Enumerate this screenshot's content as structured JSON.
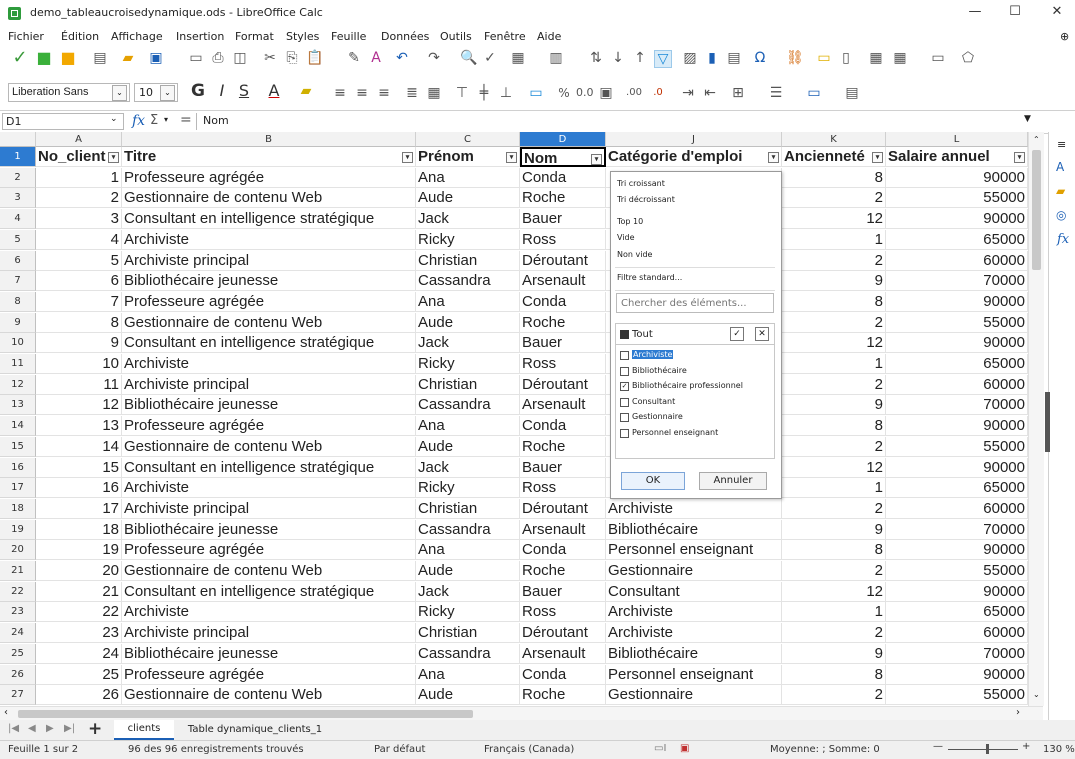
{
  "window": {
    "title": "demo_tableaucroisedynamique.ods - LibreOffice Calc"
  },
  "menu": [
    "Fichier",
    "Édition",
    "Affichage",
    "Insertion",
    "Format",
    "Styles",
    "Feuille",
    "Données",
    "Outils",
    "Fenêtre",
    "Aide"
  ],
  "toolbar": {
    "font_name": "Liberation Sans",
    "font_size": "10"
  },
  "formula_bar": {
    "cell_ref": "D1",
    "content": "Nom"
  },
  "columns": [
    "A",
    "B",
    "C",
    "D",
    "J",
    "K",
    "L"
  ],
  "headers": [
    "No_client",
    "Titre",
    "Prénom",
    "Nom",
    "Catégorie d'emploi",
    "Ancienneté",
    "Salaire annuel"
  ],
  "rows": [
    [
      "1",
      "Professeure agrégée",
      "Ana",
      "Conda",
      "",
      "8",
      "90000"
    ],
    [
      "2",
      "Gestionnaire de contenu Web",
      "Aude",
      "Roche",
      "",
      "2",
      "55000"
    ],
    [
      "3",
      "Consultant en intelligence stratégique",
      "Jack",
      "Bauer",
      "",
      "12",
      "90000"
    ],
    [
      "4",
      "Archiviste",
      "Ricky",
      "Ross",
      "",
      "1",
      "65000"
    ],
    [
      "5",
      "Archiviste principal",
      "Christian",
      "Déroutant",
      "",
      "2",
      "60000"
    ],
    [
      "6",
      "Bibliothécaire jeunesse",
      "Cassandra",
      "Arsenault",
      "",
      "9",
      "70000"
    ],
    [
      "7",
      "Professeure agrégée",
      "Ana",
      "Conda",
      "",
      "8",
      "90000"
    ],
    [
      "8",
      "Gestionnaire de contenu Web",
      "Aude",
      "Roche",
      "",
      "2",
      "55000"
    ],
    [
      "9",
      "Consultant en intelligence stratégique",
      "Jack",
      "Bauer",
      "",
      "12",
      "90000"
    ],
    [
      "10",
      "Archiviste",
      "Ricky",
      "Ross",
      "",
      "1",
      "65000"
    ],
    [
      "11",
      "Archiviste principal",
      "Christian",
      "Déroutant",
      "",
      "2",
      "60000"
    ],
    [
      "12",
      "Bibliothécaire jeunesse",
      "Cassandra",
      "Arsenault",
      "",
      "9",
      "70000"
    ],
    [
      "13",
      "Professeure agrégée",
      "Ana",
      "Conda",
      "",
      "8",
      "90000"
    ],
    [
      "14",
      "Gestionnaire de contenu Web",
      "Aude",
      "Roche",
      "",
      "2",
      "55000"
    ],
    [
      "15",
      "Consultant en intelligence stratégique",
      "Jack",
      "Bauer",
      "",
      "12",
      "90000"
    ],
    [
      "16",
      "Archiviste",
      "Ricky",
      "Ross",
      "",
      "1",
      "65000"
    ],
    [
      "17",
      "Archiviste principal",
      "Christian",
      "Déroutant",
      "Archiviste",
      "2",
      "60000"
    ],
    [
      "18",
      "Bibliothécaire jeunesse",
      "Cassandra",
      "Arsenault",
      "Bibliothécaire",
      "9",
      "70000"
    ],
    [
      "19",
      "Professeure agrégée",
      "Ana",
      "Conda",
      "Personnel enseignant",
      "8",
      "90000"
    ],
    [
      "20",
      "Gestionnaire de contenu Web",
      "Aude",
      "Roche",
      "Gestionnaire",
      "2",
      "55000"
    ],
    [
      "21",
      "Consultant en intelligence stratégique",
      "Jack",
      "Bauer",
      "Consultant",
      "12",
      "90000"
    ],
    [
      "22",
      "Archiviste",
      "Ricky",
      "Ross",
      "Archiviste",
      "1",
      "65000"
    ],
    [
      "23",
      "Archiviste principal",
      "Christian",
      "Déroutant",
      "Archiviste",
      "2",
      "60000"
    ],
    [
      "24",
      "Bibliothécaire jeunesse",
      "Cassandra",
      "Arsenault",
      "Bibliothécaire",
      "9",
      "70000"
    ],
    [
      "25",
      "Professeure agrégée",
      "Ana",
      "Conda",
      "Personnel enseignant",
      "8",
      "90000"
    ],
    [
      "26",
      "Gestionnaire de contenu Web",
      "Aude",
      "Roche",
      "Gestionnaire",
      "2",
      "55000"
    ]
  ],
  "filter_dropdown": {
    "sort_asc": "Tri croissant",
    "sort_desc": "Tri décroissant",
    "top10": "Top 10",
    "empty": "Vide",
    "not_empty": "Non vide",
    "standard_filter": "Filtre standard...",
    "search_placeholder": "Chercher des éléments...",
    "all_label": "Tout",
    "items": [
      {
        "label": "Archiviste",
        "checked": false,
        "highlighted": true
      },
      {
        "label": "Bibliothécaire",
        "checked": false,
        "highlighted": false
      },
      {
        "label": "Bibliothécaire professionnel",
        "checked": true,
        "highlighted": false
      },
      {
        "label": "Consultant",
        "checked": false,
        "highlighted": false
      },
      {
        "label": "Gestionnaire",
        "checked": false,
        "highlighted": false
      },
      {
        "label": "Personnel enseignant",
        "checked": false,
        "highlighted": false
      }
    ],
    "ok_label": "OK",
    "cancel_label": "Annuler"
  },
  "sheet_tabs": [
    "clients",
    "Table dynamique_clients_1"
  ],
  "status": {
    "sheet": "Feuille 1 sur 2",
    "records": "96 des 96 enregistrements trouvés",
    "style": "Par défaut",
    "language": "Français (Canada)",
    "sum": "Moyenne: ; Somme: 0",
    "zoom": "130 %"
  }
}
